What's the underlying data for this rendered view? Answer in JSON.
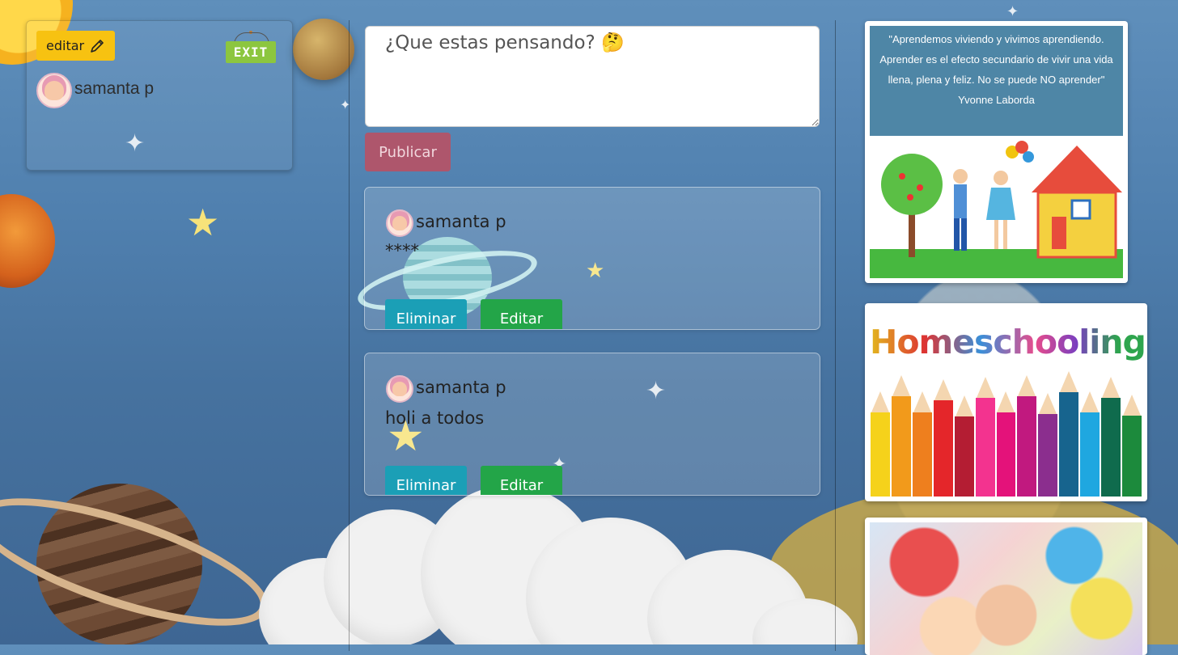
{
  "profile": {
    "edit_label": "editar",
    "exit_label": "EXIT",
    "user_name": "samanta p"
  },
  "composer": {
    "placeholder": "¿Que estas pensando? 🤔",
    "publish_label": "Publicar"
  },
  "posts": [
    {
      "author": "samanta p",
      "body": "****",
      "delete_label": "Eliminar",
      "edit_label": "Editar"
    },
    {
      "author": "samanta p",
      "body": "holi a todos",
      "delete_label": "Eliminar",
      "edit_label": "Editar"
    }
  ],
  "sidebar_images": {
    "quote_text": "\"Aprendemos viviendo y vivimos aprendiendo. Aprender es el efecto secundario de vivir una vida llena, plena y feliz. No se puede NO aprender\"",
    "quote_author": "Yvonne Laborda",
    "homeschooling_title": "Homeschooling"
  },
  "colors": {
    "edit_button": "#f7c211",
    "publish_button": "#ae566c",
    "delete_button": "#1b9fb6",
    "edit_post_button": "#23a548",
    "exit_sign": "#8cc63f"
  }
}
